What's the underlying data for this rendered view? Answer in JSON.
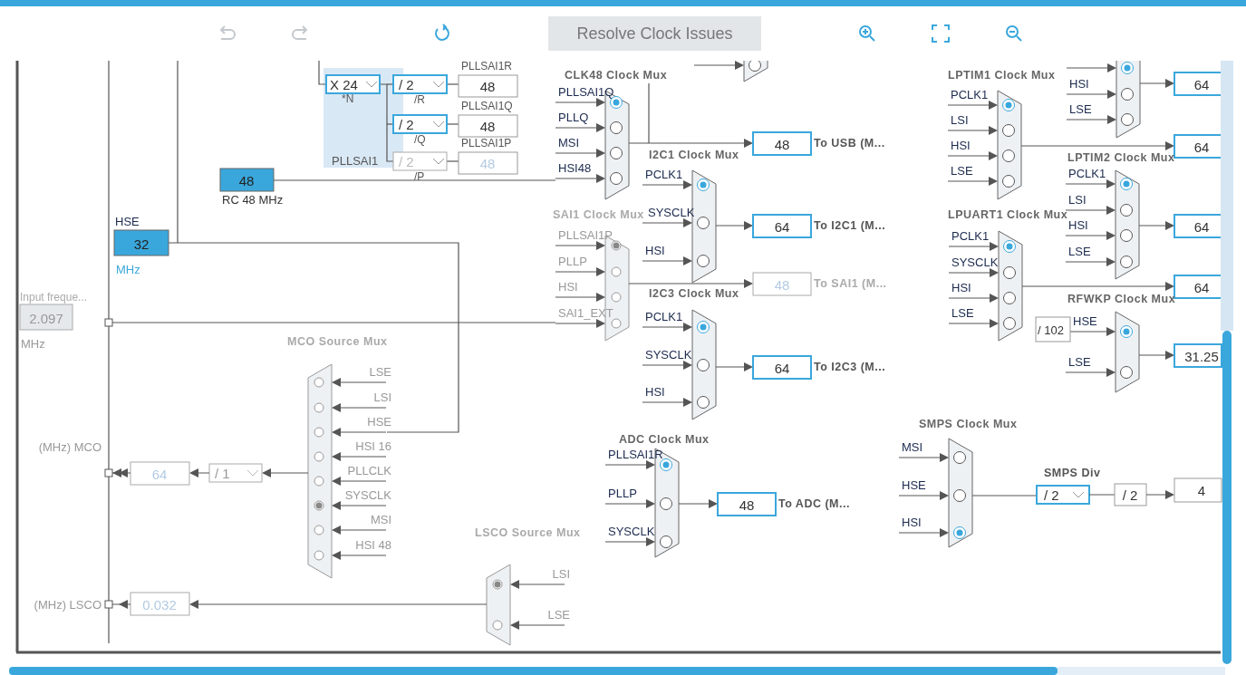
{
  "toolbar": [
    {
      "kind": "undo",
      "disabled": true
    },
    {
      "kind": "redo",
      "disabled": true
    },
    {
      "kind": "refresh",
      "disabled": false
    },
    {
      "kind": "resolve",
      "label": "Resolve Clock Issues",
      "disabled": false
    },
    {
      "kind": "zoom-in",
      "disabled": false
    },
    {
      "kind": "fit",
      "disabled": false
    },
    {
      "kind": "zoom-out",
      "disabled": false
    }
  ],
  "sources": [
    {
      "label": "HSE",
      "value": "32",
      "unit": "MHz",
      "enabled": true
    },
    {
      "label": "RC 48 MHz",
      "value": "48",
      "enabled": true
    },
    {
      "label": "Input freque...",
      "value": "2.097",
      "unit": "MHz",
      "enabled": false
    }
  ],
  "pllsai1": {
    "title": "PLLSAI1",
    "multiplier": {
      "value": "X 24",
      "label": "*N",
      "enabled": true
    },
    "outputs": [
      {
        "divider": "/ 2",
        "divider_label": "/R",
        "name": "PLLSAI1R",
        "value": "48",
        "enabled": true
      },
      {
        "divider": "/ 2",
        "divider_label": "/Q",
        "name": "PLLSAI1Q",
        "value": "48",
        "enabled": true
      },
      {
        "divider": "/ 2",
        "divider_label": "/P",
        "name": "PLLSAI1P",
        "value": "48",
        "enabled": false
      }
    ]
  },
  "muxes": [
    {
      "enabled": true,
      "inputs": [
        {
          "selected": false
        }
      ]
    },
    {
      "title": "CLK48 Clock Mux",
      "enabled": true,
      "inputs": [
        {
          "label": "PLLSAI1Q",
          "selected": true
        },
        {
          "label": "PLLQ",
          "selected": false
        },
        {
          "label": "MSI",
          "selected": false
        },
        {
          "label": "HSI48",
          "selected": false
        }
      ],
      "output": {
        "value": "48",
        "enabled": true,
        "highlighted": true,
        "label": "To USB (M..."
      }
    },
    {
      "title": "I2C1 Clock Mux",
      "enabled": true,
      "inputs": [
        {
          "label": "PCLK1",
          "selected": true
        },
        {
          "label": "SYSCLK",
          "selected": false
        },
        {
          "label": "HSI",
          "selected": false
        }
      ],
      "output": {
        "value": "64",
        "enabled": true,
        "highlighted": true,
        "label": "To I2C1 (M..."
      }
    },
    {
      "title": "SAI1 Clock Mux",
      "enabled": false,
      "inputs": [
        {
          "label": "PLLSAI1P",
          "selected": true
        },
        {
          "label": "PLLP",
          "selected": false
        },
        {
          "label": "HSI",
          "selected": false
        },
        {
          "label": "SAI1_EXT",
          "selected": false
        }
      ],
      "output": {
        "value": "48",
        "enabled": false,
        "highlighted": false,
        "label": "To SAI1 (M..."
      }
    },
    {
      "title": "I2C3 Clock Mux",
      "enabled": true,
      "inputs": [
        {
          "label": "PCLK1",
          "selected": true
        },
        {
          "label": "SYSCLK",
          "selected": false
        },
        {
          "label": "HSI",
          "selected": false
        }
      ],
      "output": {
        "value": "64",
        "enabled": true,
        "highlighted": true,
        "label": "To I2C3 (M..."
      }
    },
    {
      "title": "ADC Clock Mux",
      "enabled": true,
      "inputs": [
        {
          "label": "PLLSAI1R",
          "selected": true
        },
        {
          "label": "PLLP",
          "selected": false
        },
        {
          "label": "SYSCLK",
          "selected": false
        }
      ],
      "output": {
        "value": "48",
        "enabled": true,
        "highlighted": true,
        "label": "To ADC (M..."
      }
    },
    {
      "title": "MCO Source Mux",
      "enabled": false,
      "inputs": [
        {
          "label": "LSE",
          "selected": false
        },
        {
          "label": "LSI",
          "selected": false
        },
        {
          "label": "HSE",
          "selected": false
        },
        {
          "label": "HSI 16",
          "selected": false
        },
        {
          "label": "PLLCLK",
          "selected": false
        },
        {
          "label": "SYSCLK",
          "selected": true
        },
        {
          "label": "MSI",
          "selected": false
        },
        {
          "label": "HSI 48",
          "selected": false
        }
      ],
      "output": {
        "divider": {
          "value": "/ 1",
          "enabled": false
        },
        "value": "64",
        "enabled": false,
        "highlighted": false,
        "label": "(MHz) MCO"
      }
    },
    {
      "title": "LSCO Source Mux",
      "enabled": false,
      "inputs": [
        {
          "label": "LSI",
          "selected": true
        },
        {
          "label": "LSE",
          "selected": false
        }
      ],
      "output": {
        "value": "0.032",
        "enabled": false,
        "highlighted": false,
        "label": "(MHz) LSCO"
      }
    },
    {
      "enabled": true,
      "inputs": [
        {
          "selected": true
        },
        {
          "label": "HSI",
          "selected": false
        },
        {
          "label": "LSE",
          "selected": false
        }
      ],
      "output": {
        "value": "64",
        "enabled": true,
        "highlighted": true
      }
    },
    {
      "title": "LPTIM1 Clock Mux",
      "enabled": true,
      "inputs": [
        {
          "label": "PCLK1",
          "selected": true
        },
        {
          "label": "LSI",
          "selected": false
        },
        {
          "label": "HSI",
          "selected": false
        },
        {
          "label": "LSE",
          "selected": false
        }
      ],
      "output": {
        "value": "64",
        "enabled": true,
        "highlighted": true
      }
    },
    {
      "title": "LPTIM2 Clock Mux",
      "enabled": true,
      "inputs": [
        {
          "label": "PCLK1",
          "selected": true
        },
        {
          "label": "LSI",
          "selected": false
        },
        {
          "label": "HSI",
          "selected": false
        },
        {
          "label": "LSE",
          "selected": false
        }
      ],
      "output": {
        "value": "64",
        "enabled": true,
        "highlighted": true
      }
    },
    {
      "title": "LPUART1 Clock Mux",
      "enabled": true,
      "inputs": [
        {
          "label": "PCLK1",
          "selected": true
        },
        {
          "label": "SYSCLK",
          "selected": false
        },
        {
          "label": "HSI",
          "selected": false
        },
        {
          "label": "LSE",
          "selected": false
        }
      ],
      "output": {
        "value": "64",
        "enabled": true,
        "highlighted": true
      }
    },
    {
      "title": "RFWKP Clock Mux",
      "enabled": true,
      "prescaler": "/ 102",
      "inputs": [
        {
          "label": "HSE",
          "selected": true
        },
        {
          "label": "LSE",
          "selected": false
        }
      ],
      "output": {
        "value": "31.25",
        "enabled": true,
        "highlighted": true
      }
    },
    {
      "title": "SMPS Clock Mux",
      "enabled": true,
      "inputs": [
        {
          "label": "MSI",
          "selected": false
        },
        {
          "label": "HSE",
          "selected": false
        },
        {
          "label": "HSI",
          "selected": true
        }
      ],
      "output": {
        "title": "SMPS Div",
        "divider": {
          "value": "/ 2",
          "enabled": true
        },
        "fixed_divider": "/ 2",
        "value": "4",
        "enabled": true,
        "highlighted": false
      }
    }
  ]
}
